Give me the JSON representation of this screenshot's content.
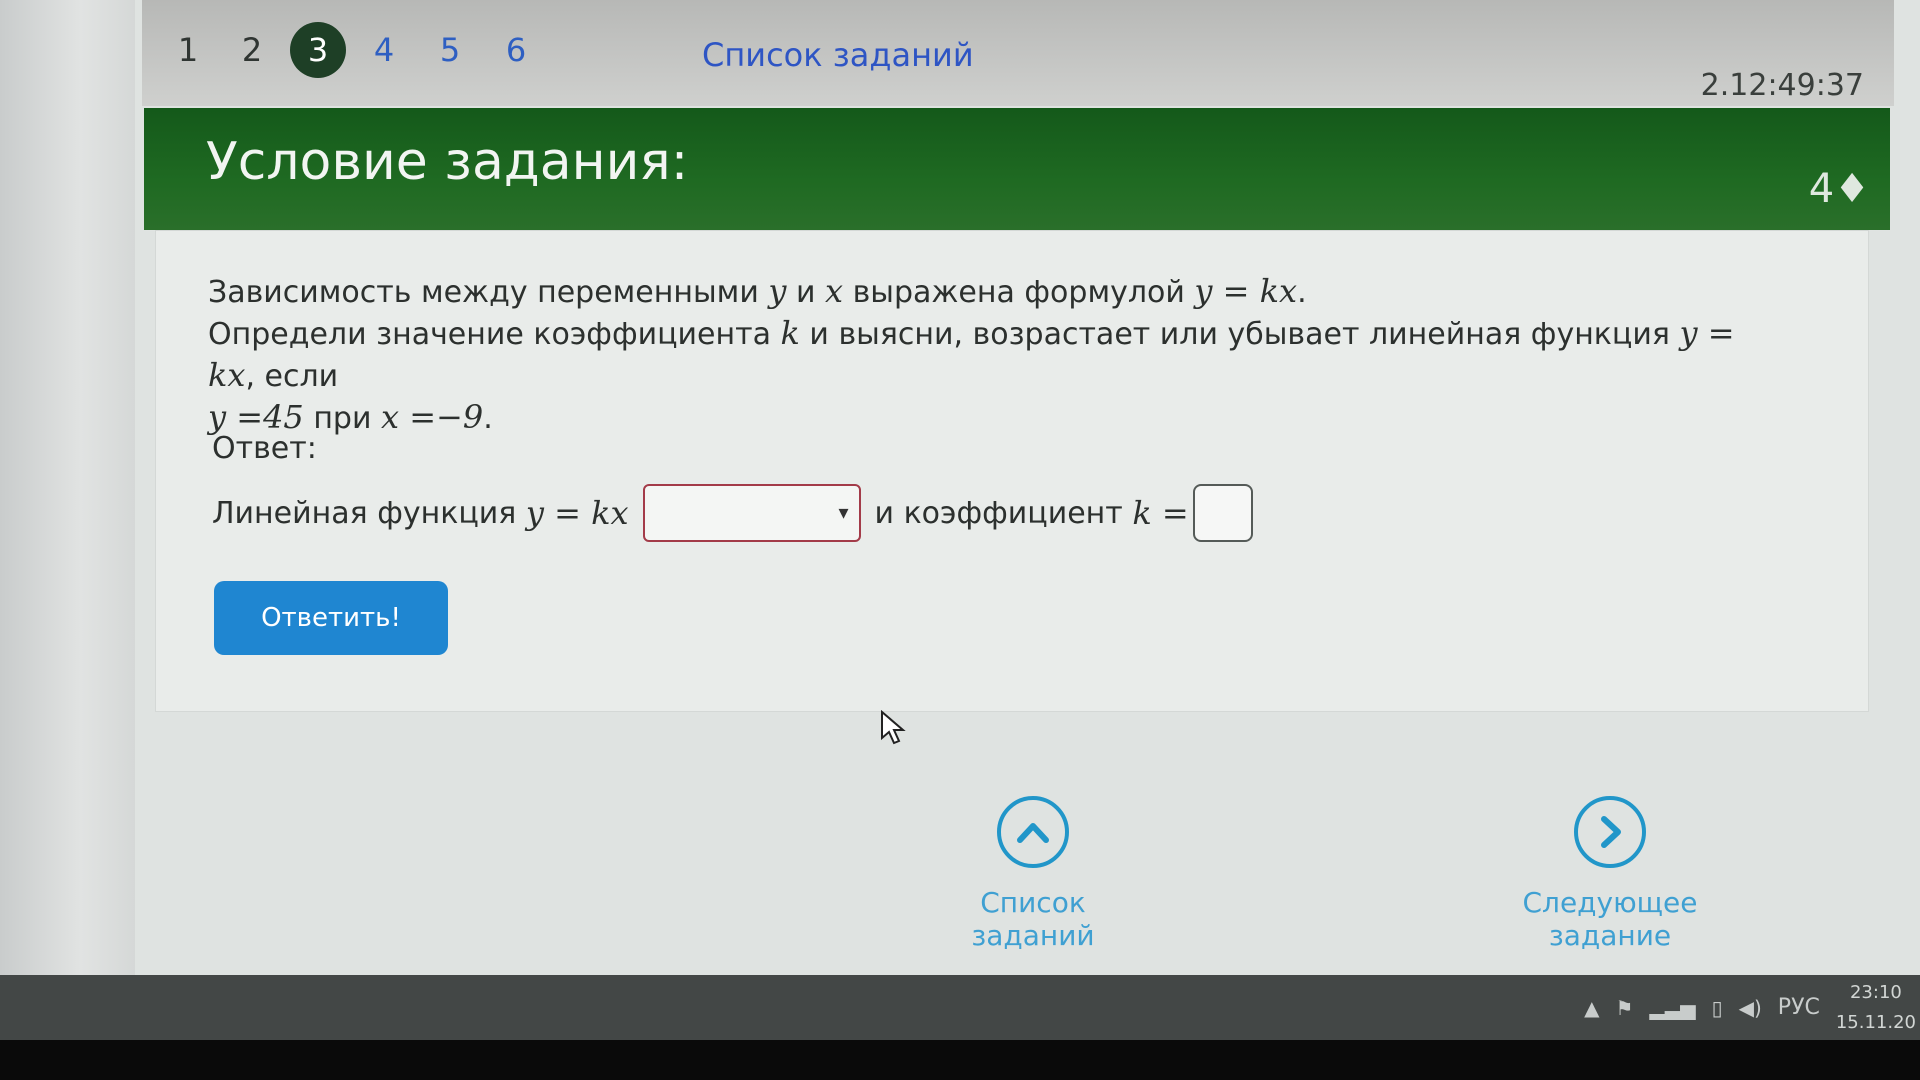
{
  "tabs": [
    {
      "label": "1",
      "state": "done"
    },
    {
      "label": "2",
      "state": "done"
    },
    {
      "label": "3",
      "state": "active"
    },
    {
      "label": "4",
      "state": "link"
    },
    {
      "label": "5",
      "state": "link"
    },
    {
      "label": "6",
      "state": "link"
    }
  ],
  "task_list_link": "Список заданий",
  "timer": "2.12:49:37",
  "header": {
    "title": "Условие задания:",
    "points": "4♦"
  },
  "problem": {
    "l1_a": "Зависимость между переменными ",
    "l1_y": "y",
    "l1_b": " и ",
    "l1_x": "x",
    "l1_c": " выражена формулой ",
    "l1_f": "y = kx",
    "l1_d": ".",
    "l2_a": "Определи значение коэффициента ",
    "l2_k": "k",
    "l2_b": " и выясни, возрастает или убывает линейная функция ",
    "l2_f": "y = kx",
    "l2_c": ", если",
    "l3_y": "y =45",
    "l3_a": " при ",
    "l3_x": "x =−9",
    "l3_b": "."
  },
  "answer": {
    "label": "Ответ:",
    "prefix": "Линейная функция ",
    "formula": "y = kx",
    "dropdown_value": "",
    "dropdown_arrow": "▾",
    "mid": "и коэффициент ",
    "k_expr": "k =",
    "k_value": ""
  },
  "submit_label": "Ответить!",
  "bottom_nav": {
    "list_label": "Список заданий",
    "next_label": "Следующее задание"
  },
  "tray": {
    "lang": "РУС",
    "time": "23:10",
    "date": "15.11.20"
  },
  "colors": {
    "header_green": "#1f6a22",
    "active_tab": "#1e3f26",
    "link_blue": "#2e55c4",
    "button_blue": "#1f86d1",
    "nav_blue": "#2196c9"
  }
}
